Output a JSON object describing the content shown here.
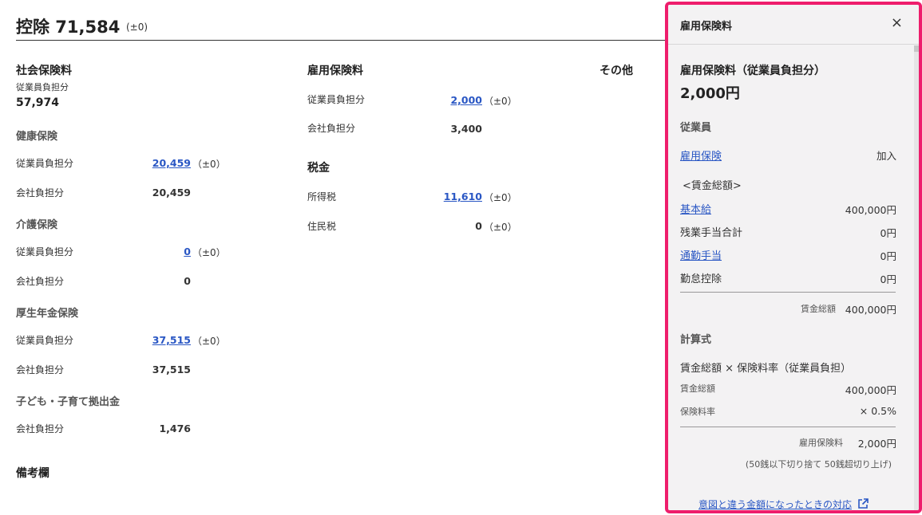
{
  "header": {
    "title": "控除 71,584",
    "delta": "(±0)"
  },
  "social_insurance": {
    "title": "社会保険料",
    "employee_label": "従業員負担分",
    "employee_total": "57,974",
    "health": {
      "title": "健康保険",
      "emp_label": "従業員負担分",
      "emp_value": "20,459",
      "emp_delta": "（±0）",
      "co_label": "会社負担分",
      "co_value": "20,459"
    },
    "care": {
      "title": "介護保険",
      "emp_label": "従業員負担分",
      "emp_value": "0",
      "emp_delta": "（±0）",
      "co_label": "会社負担分",
      "co_value": "0"
    },
    "pension": {
      "title": "厚生年金保険",
      "emp_label": "従業員負担分",
      "emp_value": "37,515",
      "emp_delta": "（±0）",
      "co_label": "会社負担分",
      "co_value": "37,515"
    },
    "child": {
      "title": "子ども・子育て拠出金",
      "co_label": "会社負担分",
      "co_value": "1,476"
    }
  },
  "employment_insurance": {
    "title": "雇用保険料",
    "emp_label": "従業員負担分",
    "emp_value": "2,000",
    "emp_delta": "（±0）",
    "co_label": "会社負担分",
    "co_value": "3,400"
  },
  "tax": {
    "title": "税金",
    "income_label": "所得税",
    "income_value": "11,610",
    "income_delta": "（±0）",
    "resident_label": "住民税",
    "resident_value": "0",
    "resident_delta": "（±0）"
  },
  "other": {
    "title": "その他"
  },
  "remarks": {
    "title": "備考欄"
  },
  "panel": {
    "title": "雇用保険料",
    "close": "×",
    "subtitle": "雇用保険料（従業員負担分）",
    "amount": "2,000円",
    "employee_section": "従業員",
    "koyo_link": "雇用保険",
    "koyo_status": "加入",
    "wage_heading": "<賃金総額>",
    "rows": [
      {
        "label": "基本給",
        "value": "400,000円"
      },
      {
        "label": "残業手当合計",
        "value": "0円"
      },
      {
        "label": "通勤手当",
        "value": "0円"
      },
      {
        "label": "勤怠控除",
        "value": "0円"
      }
    ],
    "wage_total_label": "賃金総額",
    "wage_total_value": "400,000円",
    "formula_section": "計算式",
    "formula_text": "賃金総額 × 保険料率（従業員負担）",
    "f_wage_label": "賃金総額",
    "f_wage_value": "400,000円",
    "f_rate_label": "保険料率",
    "f_rate_value": "× 0.5%",
    "result_label": "雇用保険料",
    "result_value": "2,000円",
    "rounding_note": "(50銭以下切り捨て 50銭超切り上げ)",
    "help_link": "意図と違う金額になったときの対応"
  }
}
